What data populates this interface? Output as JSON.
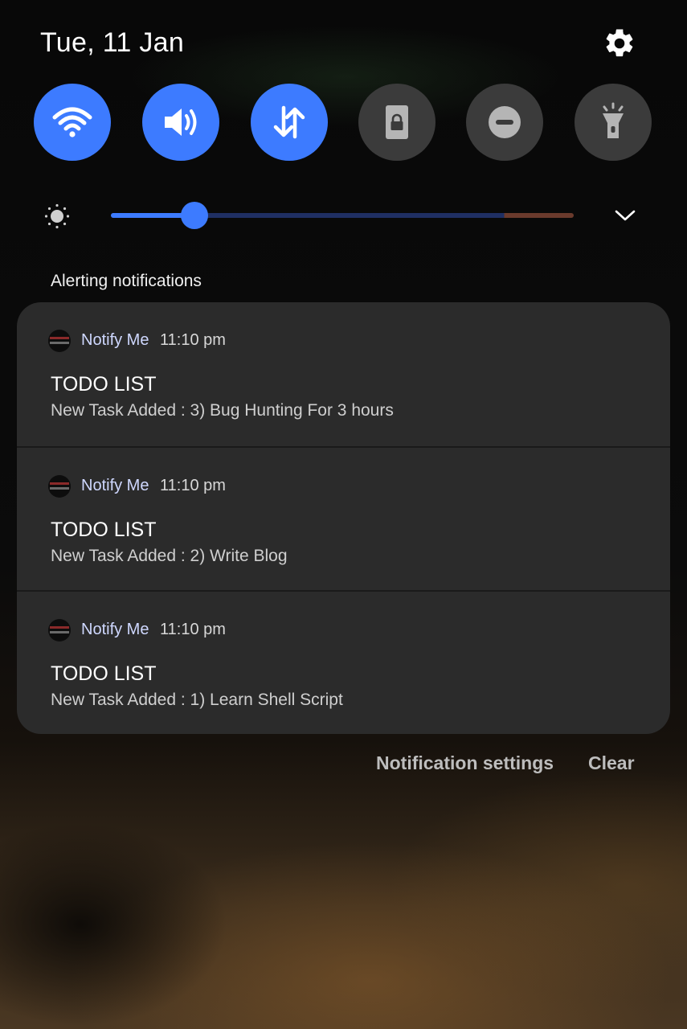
{
  "header": {
    "date": "Tue, 11 Jan",
    "settings_icon": "gear-icon"
  },
  "quick_settings": [
    {
      "name": "wifi",
      "icon": "wifi-icon",
      "state": "on"
    },
    {
      "name": "sound",
      "icon": "volume-icon",
      "state": "on"
    },
    {
      "name": "mobile-data",
      "icon": "mobile-data-icon",
      "state": "on"
    },
    {
      "name": "screen-lock",
      "icon": "lock-icon",
      "state": "off"
    },
    {
      "name": "do-not-disturb",
      "icon": "do-not-disturb-icon",
      "state": "off"
    },
    {
      "name": "flashlight",
      "icon": "flashlight-icon",
      "state": "off"
    }
  ],
  "brightness": {
    "icon": "brightness-icon",
    "level": 0.18
  },
  "section_title": "Alerting notifications",
  "notifications": [
    {
      "app": "Notify Me",
      "time": "11:10 pm",
      "title": "TODO LIST",
      "text": "New Task Added : 3) Bug Hunting For 3 hours"
    },
    {
      "app": "Notify Me",
      "time": "11:10 pm",
      "title": "TODO LIST",
      "text": "New Task Added : 2) Write Blog"
    },
    {
      "app": "Notify Me",
      "time": "11:10 pm",
      "title": "TODO LIST",
      "text": "New Task Added : 1) Learn Shell Script"
    }
  ],
  "footer": {
    "settings_label": "Notification settings",
    "clear_label": "Clear"
  },
  "colors": {
    "accent": "#3d7bff",
    "tile_off": "#3b3b3b",
    "card": "#2b2b2b"
  }
}
